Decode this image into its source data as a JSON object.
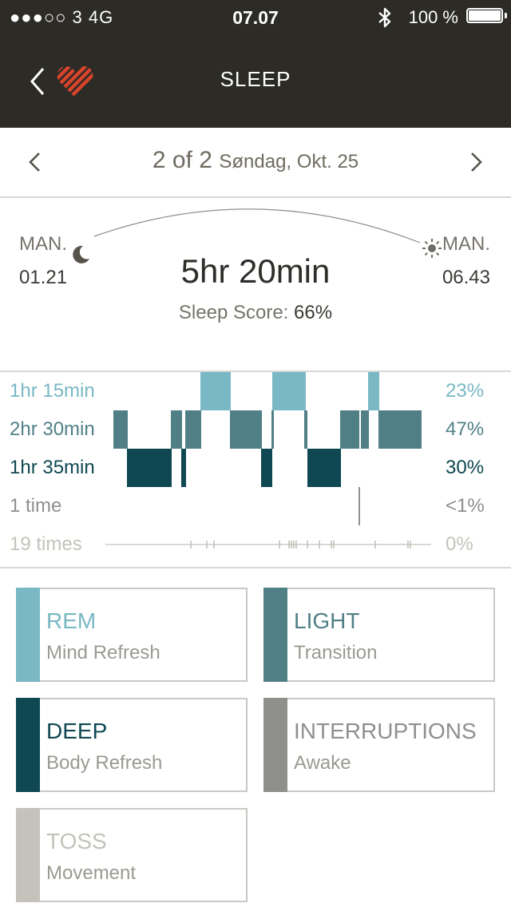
{
  "status_bar": {
    "carrier": "●●●○○ 3   4G",
    "time": "07.07",
    "battery": "100 %"
  },
  "header": {
    "title": "SLEEP"
  },
  "date_nav": {
    "page": "2 of 2",
    "date": "Søndag, Okt. 25"
  },
  "summary": {
    "bedtime_day": "MAN.",
    "bedtime": "01.21",
    "wake_day": "MAN.",
    "wake_time": "06.43",
    "duration": "5hr 20min",
    "score_label": "Sleep Score:",
    "score_value": "66%"
  },
  "stages": [
    {
      "key": "rem",
      "left": "1hr 15min",
      "right": "23%",
      "color": "#79b8c4"
    },
    {
      "key": "light",
      "left": "2hr 30min",
      "right": "47%",
      "color": "#508086"
    },
    {
      "key": "deep",
      "left": "1hr 35min",
      "right": "30%",
      "color": "#0f4853"
    },
    {
      "key": "interruptions",
      "left": "1 time",
      "right": "<1%",
      "color": "#8f8f8d"
    },
    {
      "key": "toss",
      "left": "19 times",
      "right": "0%",
      "color": "#c3c2bb"
    }
  ],
  "legend": {
    "rem": {
      "title": "REM",
      "subtitle": "Mind Refresh"
    },
    "light": {
      "title": "LIGHT",
      "subtitle": "Transition"
    },
    "deep": {
      "title": "DEEP",
      "subtitle": "Body Refresh"
    },
    "interruptions": {
      "title": "INTERRUPTIONS",
      "subtitle": "Awake"
    },
    "toss": {
      "title": "TOSS",
      "subtitle": "Movement"
    }
  }
}
